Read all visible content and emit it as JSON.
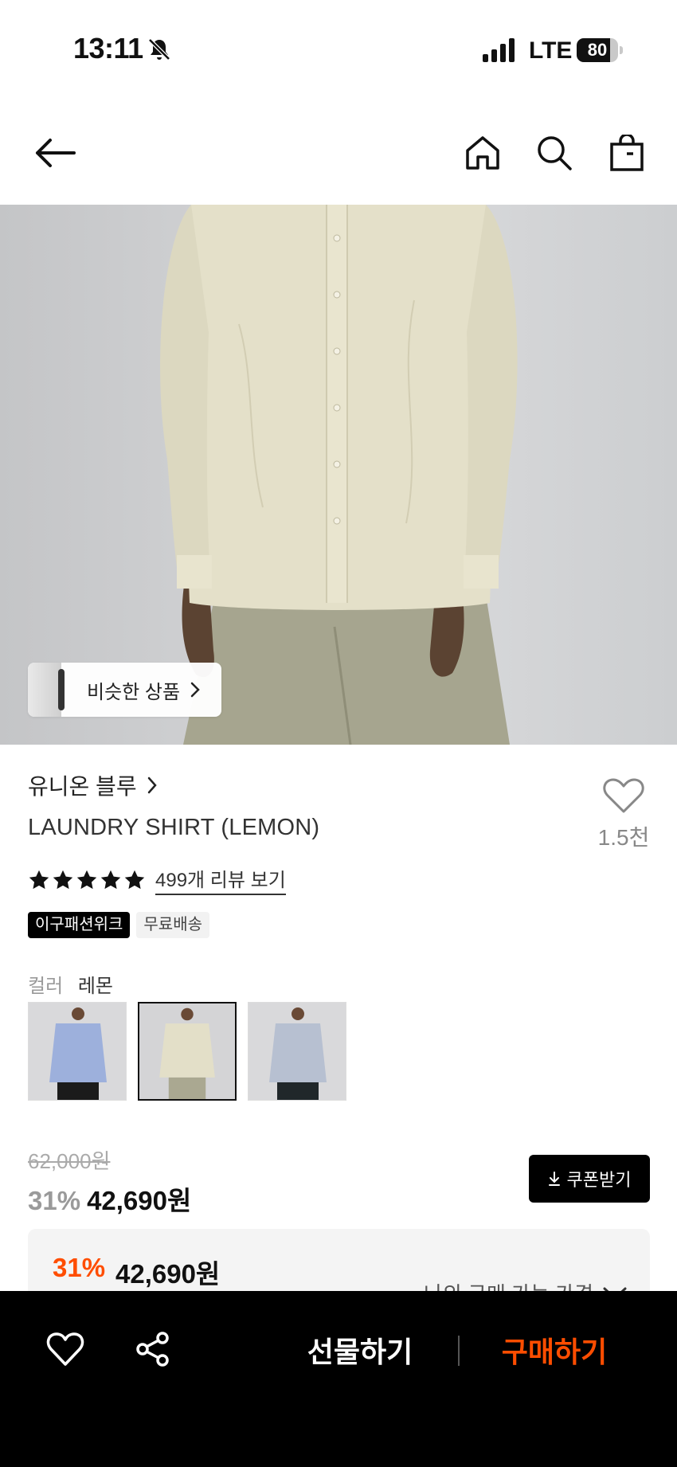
{
  "status_bar": {
    "time": "13:11",
    "network": "LTE",
    "battery_level": 80,
    "battery_label": "80"
  },
  "header": {
    "icons": [
      "back-arrow-icon",
      "home-icon",
      "search-icon",
      "shopping-bag-icon"
    ]
  },
  "hero": {
    "similar_products_label": "비슷한 상품"
  },
  "product": {
    "brand": "유니온 블루",
    "title": "LAUNDRY SHIRT (LEMON)",
    "rating_stars": 5,
    "review_link": "499개 리뷰 보기",
    "wishlist_count": "1.5천",
    "tags": [
      "이구패션위크",
      "무료배송"
    ],
    "color_label": "컬러",
    "color_value": "레몬",
    "color_options": [
      "blue",
      "lemon",
      "light-blue"
    ],
    "selected_color_index": 1,
    "original_price": "62,000원",
    "discount": "31%",
    "sale_price": "42,690원",
    "coupon_button": "쿠폰받기",
    "my_price": {
      "discount": "31%",
      "price": "42,690원",
      "link": "나의 구매 가능 가격"
    }
  },
  "bottom_bar": {
    "gift_button": "선물하기",
    "buy_button": "구매하기"
  },
  "colors": {
    "accent": "#ff4d00",
    "bottom_bar_bg": "#000000",
    "swatch_blue": "#9db0dc",
    "swatch_lemon": "#e3dfc8",
    "swatch_light_blue": "#b7c0d1"
  }
}
